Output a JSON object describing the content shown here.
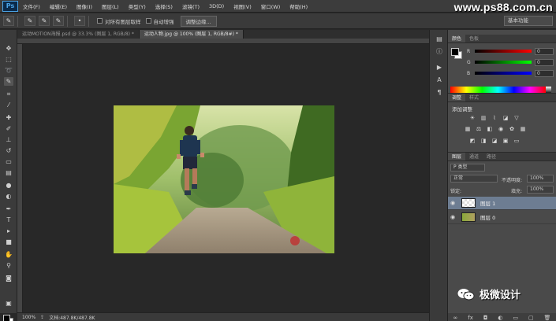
{
  "app": {
    "logo_text": "Ps"
  },
  "menu": [
    "文件(F)",
    "编辑(E)",
    "图像(I)",
    "图层(L)",
    "类型(Y)",
    "选择(S)",
    "滤镜(T)",
    "3D(D)",
    "视图(V)",
    "窗口(W)",
    "帮助(H)"
  ],
  "watermark_top": "www.ps88.com.cn",
  "options": {
    "sample_all_layers": "对所有图层取样",
    "auto_enhance": "自动增强",
    "refine_edge": "调整边缘...",
    "workspace": "基本功能"
  },
  "tabs": [
    {
      "label": "运动MOTION海报.psd @ 33.3% (图层 1, RGB/8) *",
      "active": false
    },
    {
      "label": "运动人物.jpg @ 100% (图层 1, RGB/8#) *",
      "active": true
    }
  ],
  "status": {
    "zoom": "100%",
    "doc": "文档:487.8K/487.8K"
  },
  "panels": {
    "color_tabs": [
      "颜色",
      "色板"
    ],
    "color_labels": {
      "r": "R",
      "g": "G",
      "b": "B"
    },
    "color_values": {
      "r": "0",
      "g": "0",
      "b": "0"
    },
    "adj_tabs": [
      "调整",
      "样式"
    ],
    "adj_title": "添加调整",
    "layers_tabs": [
      "图层",
      "通道",
      "路径"
    ],
    "kind_filter": "P 类型",
    "blend_mode": "正常",
    "opacity_label": "不透明度:",
    "opacity_value": "100%",
    "lock_label": "锁定:",
    "fill_label": "填充:",
    "fill_value": "100%",
    "layers": [
      {
        "name": "图层 1",
        "selected": true
      },
      {
        "name": "图层 0",
        "selected": false
      }
    ]
  },
  "watermark_bottom": "极微设计",
  "colors": {
    "accent": "#4aa3e6",
    "layer_selected": "#6d7d92"
  }
}
